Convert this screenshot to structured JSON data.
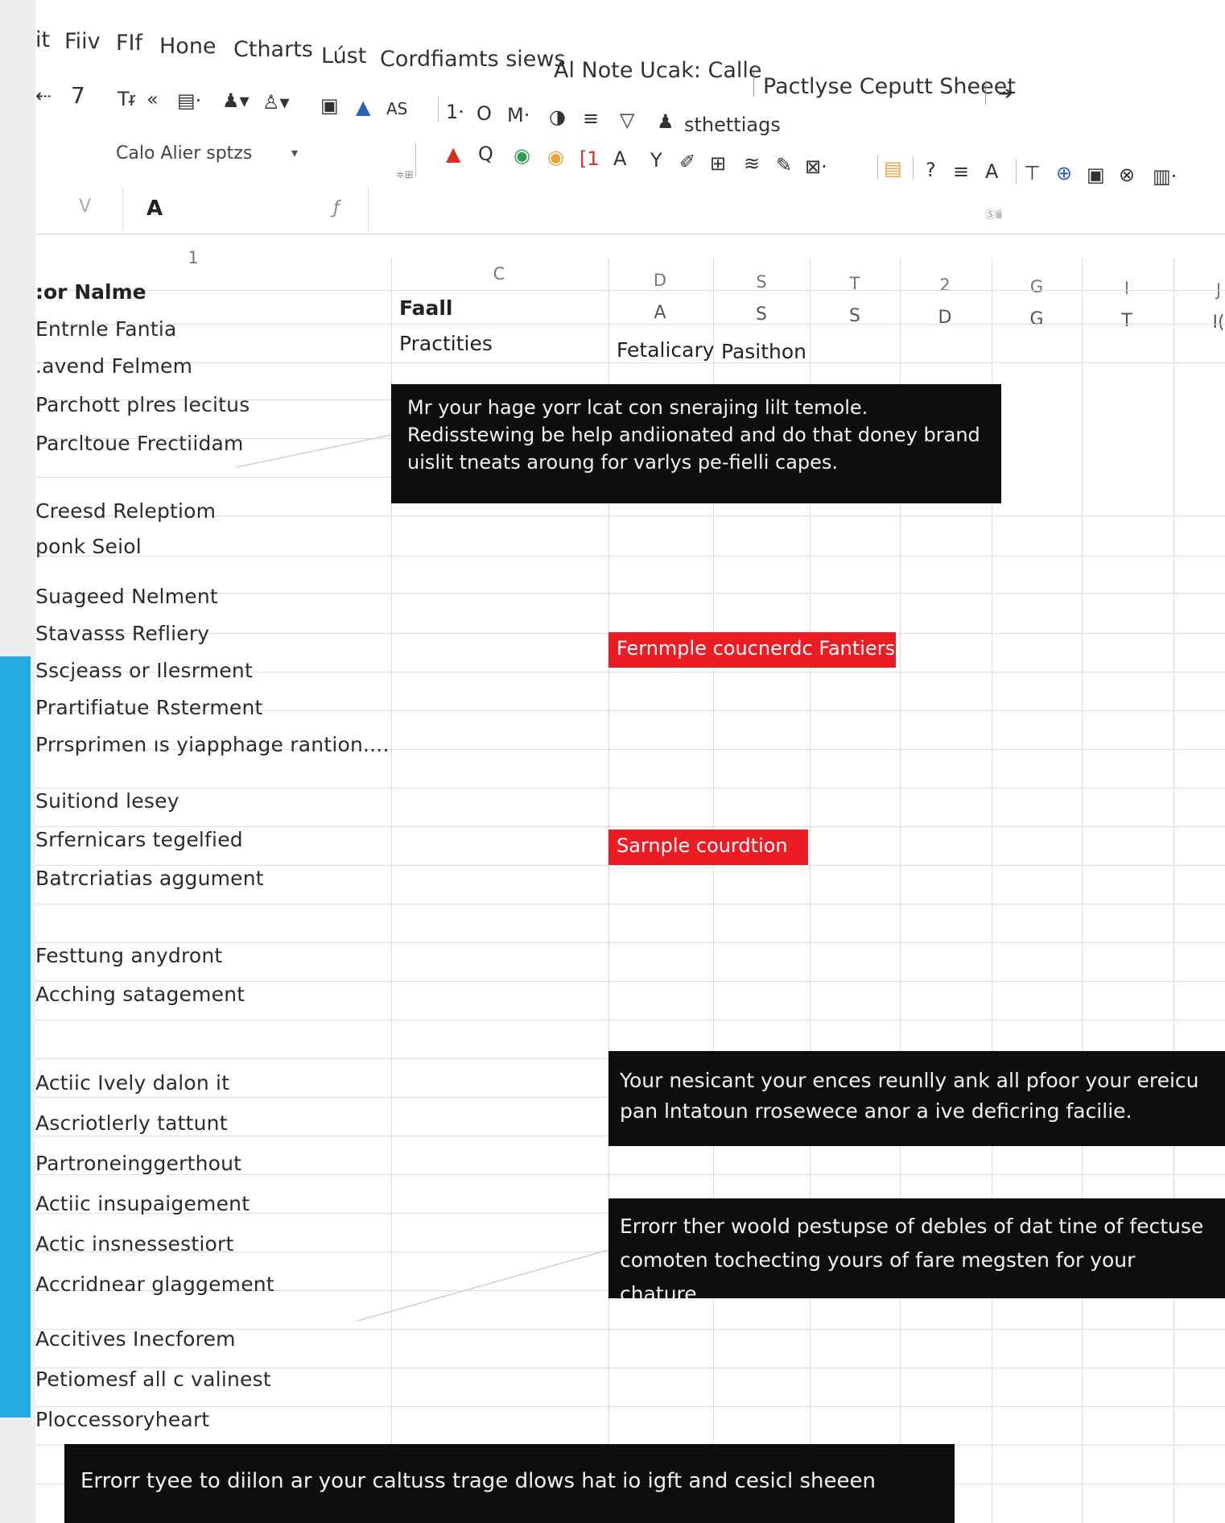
{
  "menu": [
    "it",
    "Fiiv",
    "FIf",
    "Hone",
    "Ctharts",
    "Lúst",
    "Cordfiamts siews",
    "Al Note Ucak: Calle",
    "Pactlyse Ceputt Sheeet"
  ],
  "toolbar": {
    "row1": [
      "⇠",
      "7",
      "Tᵲ",
      "«",
      "▤·",
      "♟▾",
      "♙▾",
      "▣",
      "▲",
      "AS",
      "1·",
      "O",
      "M·",
      "◑",
      "≡",
      "▽",
      "♟",
      "sthettiags"
    ],
    "font_box": "Calo Alier sptzs",
    "tiny_left": "≑⊞",
    "tiny_right": "Ⓢⅲ",
    "row2": [
      "▲",
      "Q",
      "◉",
      "◉",
      "[1",
      "A",
      "Y",
      "✐",
      "⊞",
      "≋",
      "✎",
      "⊠·",
      "▤",
      "?",
      "≡",
      "A",
      "⊤",
      "⊕",
      "▣",
      "⊗",
      "▥·"
    ]
  },
  "formula_bar": {
    "name_box": "V",
    "content": "A",
    "fx": "ƒ"
  },
  "columns": {
    "first_header": "1",
    "c_header": "C",
    "letters": [
      "D",
      "S",
      "T",
      "2",
      "G",
      "I",
      "J"
    ],
    "subheaders": [
      "A",
      "S",
      "S",
      "D",
      "G",
      "T",
      "I("
    ]
  },
  "cells": {
    "name_header": ":or Nalme",
    "faall": "Faall",
    "practities": "Practities",
    "fetalicary": "Fetalicary",
    "pasithon": "Pasithon"
  },
  "rows": [
    "Entrnle Fantia",
    ".avend Felmem",
    "Parchott plres lecitus",
    "Parcltoue Frectiidam",
    "Creesd Releptiom",
    "ponk Seiol",
    "Suageed Nelment",
    "Stavasss Refliery",
    "Sscjeass or Ilesrment",
    "Prartifiatue Rsterment",
    "Prrsprimen ıs yiapphage rantion....",
    "Suitiond lesey",
    "Srfernicars tegelfied",
    "Batrcriatias aggument",
    "Festtung anydront",
    "Acching satagement",
    "Actiic Ively dalon it",
    "Ascriotlerly tattunt",
    "Partroneinggerthout",
    "Actiic insupaigement",
    "Actic insnessestiort",
    "Accridnear glaggement",
    "Accitives Inecforem",
    "Petiomesf all c valinest",
    "Ploccessoryheart"
  ],
  "notes": [
    "Mr your hage yorr lcat con snerajing lilt temole. Redisstewing be help andiionated and do that doney brand uislit tneats aroung for varlys pe-fielli capes.",
    "Your nesicant your ences reunlly ank all pfoor your ereicu pan lntatoun rrosewece anor a ive deficring facilie.",
    "Errorr ther woold pestupse of debles of dat tine of fectuse comoten tochecting yours of fare megsten for your chature.",
    "Errorr tyee to diilon ar your caltuss trage dlows hat io igft and cesicl sheeen"
  ],
  "red_tags": [
    "Fernmple coucnerdc Fantiers",
    "Sarnple courdtion"
  ],
  "colors": {
    "accent_blue": "#22ace0",
    "tag_red": "#ec1c24",
    "note_bg": "#0e0e0e"
  }
}
